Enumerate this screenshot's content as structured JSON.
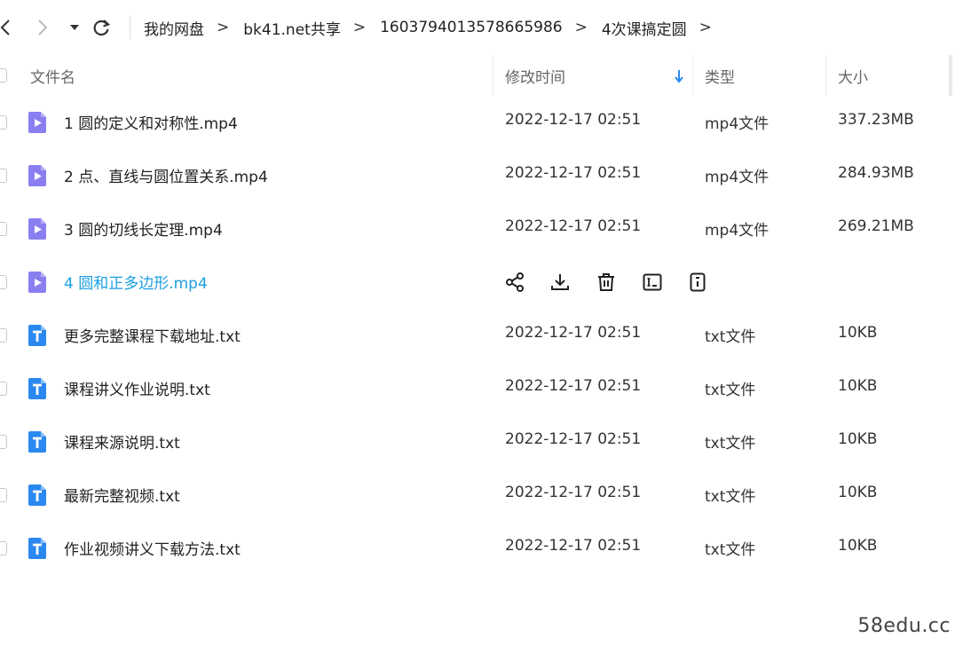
{
  "breadcrumb": [
    "我的网盘",
    "bk41.net共享",
    "1603794013578665986",
    "4次课搞定圆"
  ],
  "breadcrumb_separator": ">",
  "columns": {
    "name": "文件名",
    "modified": "修改时间",
    "type": "类型",
    "size": "大小"
  },
  "files": [
    {
      "name": "1 圆的定义和对称性.mp4",
      "modified": "2022-12-17 02:51",
      "type": "mp4文件",
      "size": "337.23MB",
      "icon": "video-file-icon"
    },
    {
      "name": "2 点、直线与圆位置关系.mp4",
      "modified": "2022-12-17 02:51",
      "type": "mp4文件",
      "size": "284.93MB",
      "icon": "video-file-icon"
    },
    {
      "name": "3 圆的切线长定理.mp4",
      "modified": "2022-12-17 02:51",
      "type": "mp4文件",
      "size": "269.21MB",
      "icon": "video-file-icon"
    },
    {
      "name": "4 圆和正多边形.mp4",
      "modified": "",
      "type": "",
      "size": "",
      "icon": "video-file-icon",
      "hovered": true
    },
    {
      "name": "更多完整课程下载地址.txt",
      "modified": "2022-12-17 02:51",
      "type": "txt文件",
      "size": "10KB",
      "icon": "text-file-icon"
    },
    {
      "name": "课程讲义作业说明.txt",
      "modified": "2022-12-17 02:51",
      "type": "txt文件",
      "size": "10KB",
      "icon": "text-file-icon"
    },
    {
      "name": "课程来源说明.txt",
      "modified": "2022-12-17 02:51",
      "type": "txt文件",
      "size": "10KB",
      "icon": "text-file-icon"
    },
    {
      "name": "最新完整视频.txt",
      "modified": "2022-12-17 02:51",
      "type": "txt文件",
      "size": "10KB",
      "icon": "text-file-icon"
    },
    {
      "name": "作业视频讲义下载方法.txt",
      "modified": "2022-12-17 02:51",
      "type": "txt文件",
      "size": "10KB",
      "icon": "text-file-icon"
    }
  ],
  "hover_actions": [
    "share-icon",
    "download-icon",
    "delete-icon",
    "rename-icon",
    "info-icon"
  ],
  "watermark": "58edu.cc",
  "colors": {
    "accent": "#1a9fe0",
    "video_icon": "#8a7ff0",
    "text_icon": "#2b88f0"
  }
}
